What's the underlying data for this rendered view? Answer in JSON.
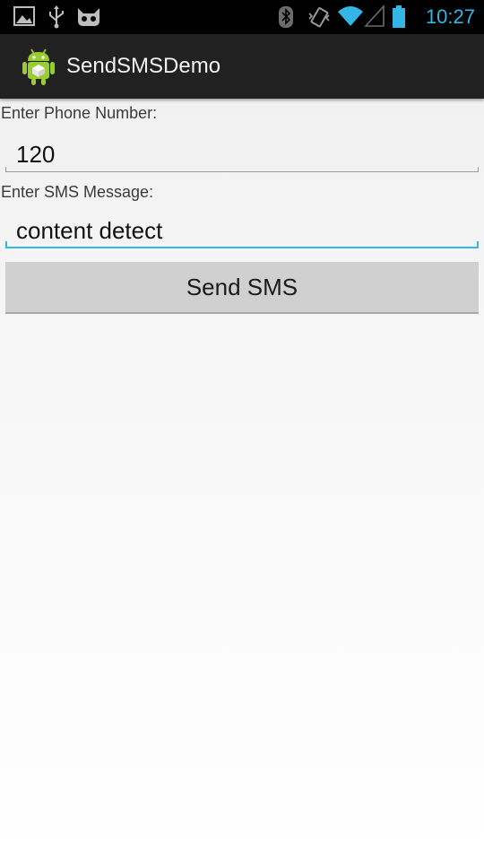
{
  "status_bar": {
    "time": "10:27",
    "icons": [
      "gallery-icon",
      "usb-icon",
      "cyanogenmod-icon",
      "bluetooth-icon",
      "vibrate-icon",
      "wifi-icon",
      "signal-icon",
      "battery-icon"
    ],
    "accent_color": "#33b5e5"
  },
  "action_bar": {
    "title": "SendSMSDemo",
    "icon": "android-app-icon",
    "background": "#212121"
  },
  "form": {
    "phone_label": "Enter Phone Number:",
    "phone_value": "120",
    "message_label": "Enter SMS Message:",
    "message_value": "content detect",
    "send_button_label": "Send SMS"
  }
}
